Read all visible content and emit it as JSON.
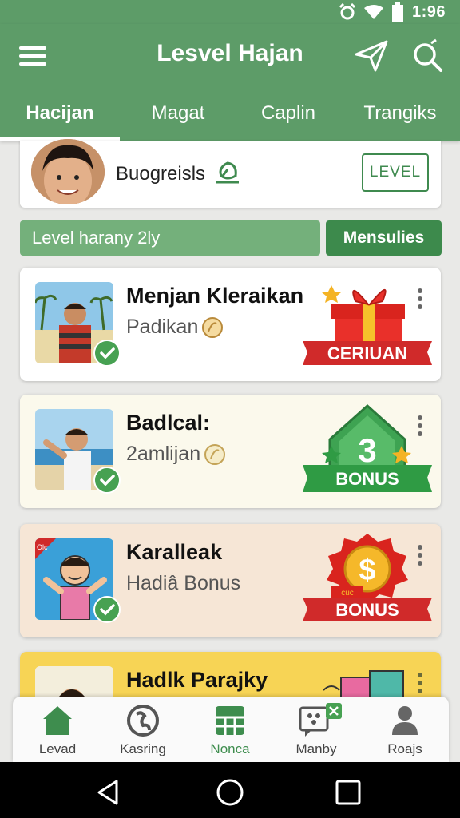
{
  "status_bar": {
    "time": "1:96",
    "icons": [
      "alarm-icon",
      "wifi-icon",
      "battery-icon"
    ]
  },
  "app_bar": {
    "title": "Lesvel Hajan",
    "icons": [
      "menu-icon",
      "send-icon",
      "search-icon"
    ],
    "tabs": [
      {
        "label": "Hacijan",
        "active": true
      },
      {
        "label": "Magat",
        "active": false
      },
      {
        "label": "Caplin",
        "active": false
      },
      {
        "label": "Trangiks",
        "active": false
      }
    ]
  },
  "profile": {
    "name": "Buogreisls",
    "badge_icon": "leaf-icon",
    "level_button": "LEVEL"
  },
  "level_row": {
    "text": "Level harany 2ly",
    "button": "Mensulies"
  },
  "cards": [
    {
      "title": "Menjan Kleraikan",
      "subtitle": "Padikan",
      "badge_text": "CERIUAN",
      "background": "#ffffff"
    },
    {
      "title": "Badlcal:",
      "subtitle": "2amlijan",
      "badge_number": "3",
      "badge_text": "BONUS",
      "background": "#fbf9ec"
    },
    {
      "title": "Karalleak",
      "subtitle": "Hadiâ Bonus",
      "badge_symbol": "$",
      "badge_text": "BONUS",
      "badge_small": "cuc",
      "thumb_tag": "Olc",
      "background": "#f6e6d6"
    },
    {
      "title": "Hadlk Parajky",
      "background": "#f7d455"
    }
  ],
  "bottom_nav": [
    {
      "label": "Levad",
      "icon": "home-icon",
      "active": false
    },
    {
      "label": "Kasring",
      "icon": "globe-icon",
      "active": false
    },
    {
      "label": "Nonca",
      "icon": "grid-icon",
      "active": true
    },
    {
      "label": "Manby",
      "icon": "chat-icon",
      "active": false
    },
    {
      "label": "Roajs",
      "icon": "person-icon",
      "active": false
    }
  ],
  "colors": {
    "primary": "#5d9c68",
    "dark_green": "#3d8a4c",
    "check_green": "#47a152",
    "bonus_red": "#d02a2a",
    "active_nav": "#3e8d4e"
  }
}
